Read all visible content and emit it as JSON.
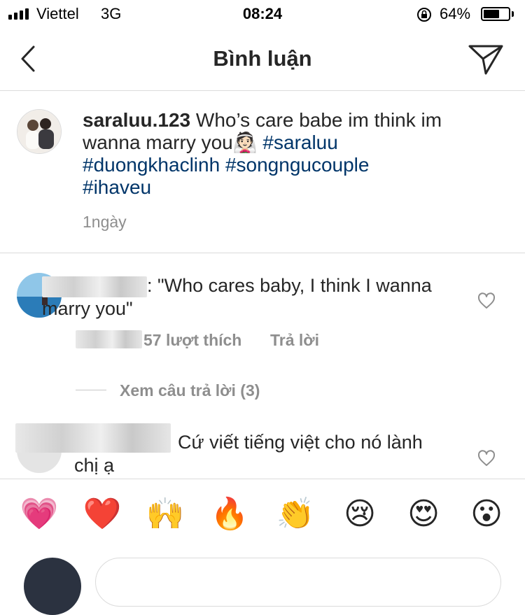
{
  "status_bar": {
    "carrier": "Viettel",
    "network": "3G",
    "time": "08:24",
    "battery_percent": "64%",
    "battery_level": 0.64
  },
  "nav": {
    "title": "Bình luận"
  },
  "caption": {
    "username": "saraluu.123",
    "text": " Who’s care babe im think im wanna marry you",
    "emoji": "👰🏻",
    "hashtags": [
      "#saraluu",
      "#duongkhaclinh",
      "#songngucouple",
      "#ihaveu"
    ],
    "time": "1ngày"
  },
  "comments": [
    {
      "username_suffix": ":",
      "text": " \"Who cares baby, I think I wanna marry you\"",
      "likes": "57 lượt thích",
      "reply_label": "Trả lời"
    },
    {
      "text": "Cứ viết tiếng việt cho nó lành chị ạ"
    }
  ],
  "view_replies": "Xem câu trả lời (3)",
  "emoji_bar": [
    "💗",
    "❤️",
    "🙌",
    "🔥",
    "👏",
    "😢",
    "😍",
    "😮"
  ]
}
